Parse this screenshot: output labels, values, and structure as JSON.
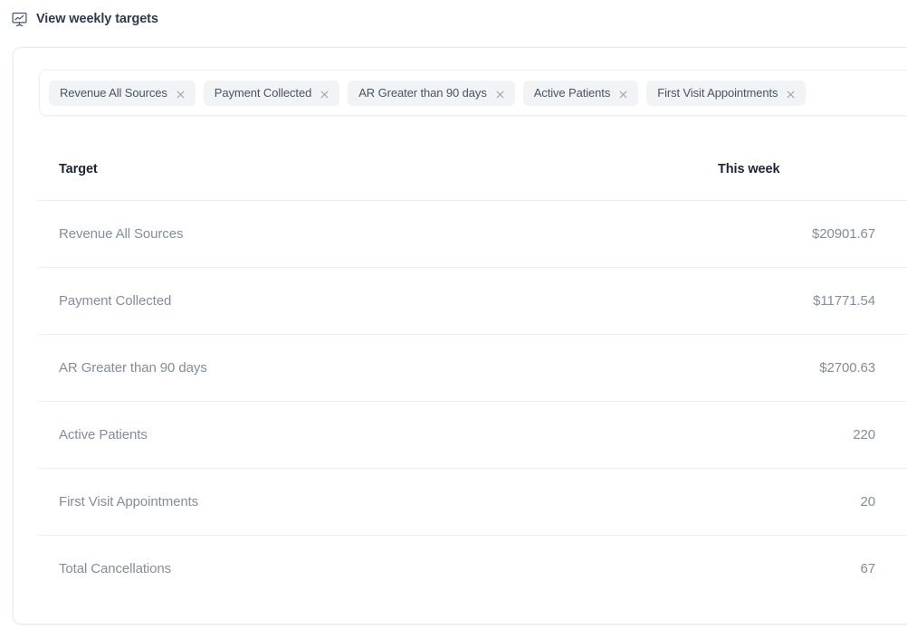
{
  "header": {
    "icon": "presentation-chart-icon",
    "title": "View weekly targets"
  },
  "filter": {
    "close_icon": "close-icon",
    "chips": [
      {
        "label": "Revenue All Sources"
      },
      {
        "label": "Payment Collected"
      },
      {
        "label": "AR Greater than 90 days"
      },
      {
        "label": "Active Patients"
      },
      {
        "label": "First Visit Appointments"
      }
    ]
  },
  "table": {
    "columns": {
      "target": "Target",
      "this_week": "This week"
    },
    "rows": [
      {
        "target": "Revenue All Sources",
        "this_week": "$20901.67"
      },
      {
        "target": "Payment Collected",
        "this_week": "$11771.54"
      },
      {
        "target": "AR Greater than 90 days",
        "this_week": "$2700.63"
      },
      {
        "target": "Active Patients",
        "this_week": "220"
      },
      {
        "target": "First Visit Appointments",
        "this_week": "20"
      },
      {
        "target": "Total Cancellations",
        "this_week": "67"
      }
    ]
  },
  "colors": {
    "header_text": "#2f3a4e",
    "column_header_text": "#1c2536",
    "body_text": "#848d9b",
    "chip_background": "#f1f3f5",
    "chip_text": "#4a5463",
    "card_border": "#e9ecef",
    "row_divider": "#eceef0"
  }
}
